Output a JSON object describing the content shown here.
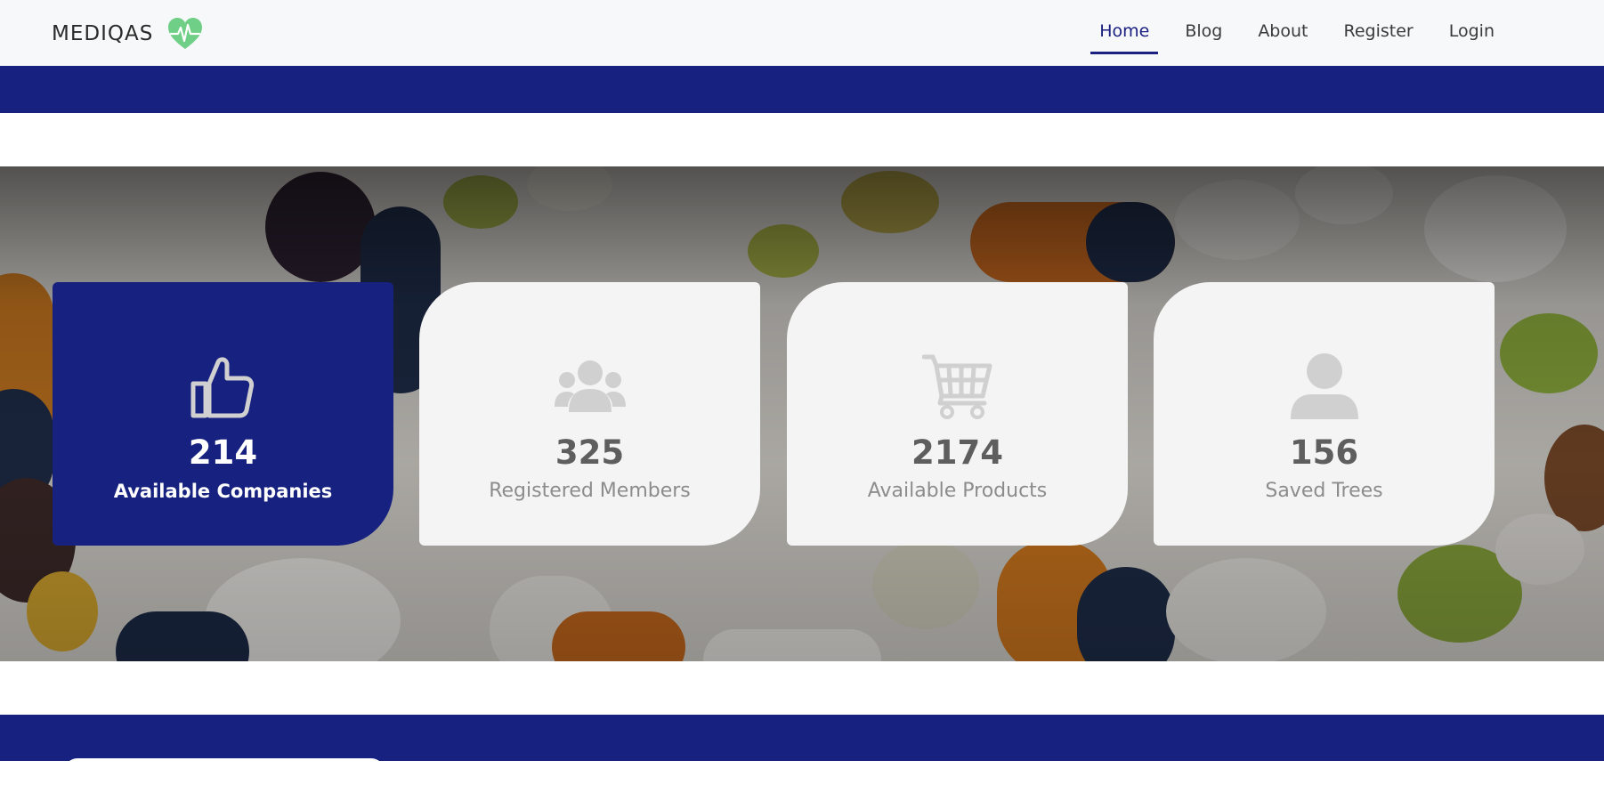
{
  "brand": {
    "name": "MEDIQAS",
    "icon": "heart-pulse-icon",
    "icon_color": "#6fcf86"
  },
  "nav": {
    "items": [
      {
        "label": "Home",
        "active": true
      },
      {
        "label": "Blog",
        "active": false
      },
      {
        "label": "About",
        "active": false
      },
      {
        "label": "Register",
        "active": false
      },
      {
        "label": "Login",
        "active": false
      }
    ],
    "active_color": "#1a2180"
  },
  "stats": [
    {
      "icon": "thumbs-up-icon",
      "value": "214",
      "label": "Available Companies",
      "active": true
    },
    {
      "icon": "users-icon",
      "value": "325",
      "label": "Registered Members",
      "active": false
    },
    {
      "icon": "shopping-cart-icon",
      "value": "2174",
      "label": "Available Products",
      "active": false
    },
    {
      "icon": "user-icon",
      "value": "156",
      "label": "Saved Trees",
      "active": false
    }
  ],
  "colors": {
    "primary": "#17217f",
    "card_bg": "#f4f4f4",
    "navbar_bg": "#f7f8f9"
  }
}
